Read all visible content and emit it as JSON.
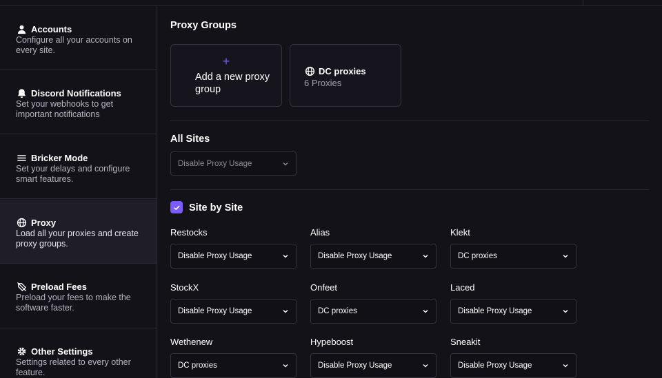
{
  "sidebar": {
    "items": [
      {
        "icon": "user-icon",
        "title": "Accounts",
        "desc": "Configure all your accounts on every site."
      },
      {
        "icon": "bell-icon",
        "title": "Discord Notifications",
        "desc": "Set your webhooks to get important notifications"
      },
      {
        "icon": "menu-icon",
        "title": "Bricker Mode",
        "desc": "Set your delays and configure smart features."
      },
      {
        "icon": "globe-icon",
        "title": "Proxy",
        "desc": "Load all your proxies and create proxy groups."
      },
      {
        "icon": "no-tag-icon",
        "title": "Preload Fees",
        "desc": "Preload your fees to make the software faster."
      },
      {
        "icon": "gear-icon",
        "title": "Other Settings",
        "desc": "Settings related to every other feature."
      }
    ],
    "active_index": 3
  },
  "proxy_groups": {
    "title": "Proxy Groups",
    "add_card": {
      "plus": "+",
      "label": "Add a new proxy group"
    },
    "groups": [
      {
        "name": "DC proxies",
        "count": "6 Proxies",
        "icon": "globe-icon"
      }
    ]
  },
  "all_sites": {
    "title": "All Sites",
    "value": "Disable Proxy Usage"
  },
  "site_by_site": {
    "title": "Site by Site",
    "checked": true,
    "sites": [
      {
        "name": "Restocks",
        "value": "Disable Proxy Usage"
      },
      {
        "name": "Alias",
        "value": "Disable Proxy Usage"
      },
      {
        "name": "Klekt",
        "value": "DC proxies"
      },
      {
        "name": "StockX",
        "value": "Disable Proxy Usage"
      },
      {
        "name": "Onfeet",
        "value": "DC proxies"
      },
      {
        "name": "Laced",
        "value": "Disable Proxy Usage"
      },
      {
        "name": "Wethenew",
        "value": "DC proxies"
      },
      {
        "name": "Hypeboost",
        "value": "Disable Proxy Usage"
      },
      {
        "name": "Sneakit",
        "value": "Disable Proxy Usage"
      }
    ]
  },
  "colors": {
    "accent": "#7c5cff",
    "background": "#131219",
    "sidebar_active": "#1f1e28",
    "border": "#2b2a33"
  }
}
